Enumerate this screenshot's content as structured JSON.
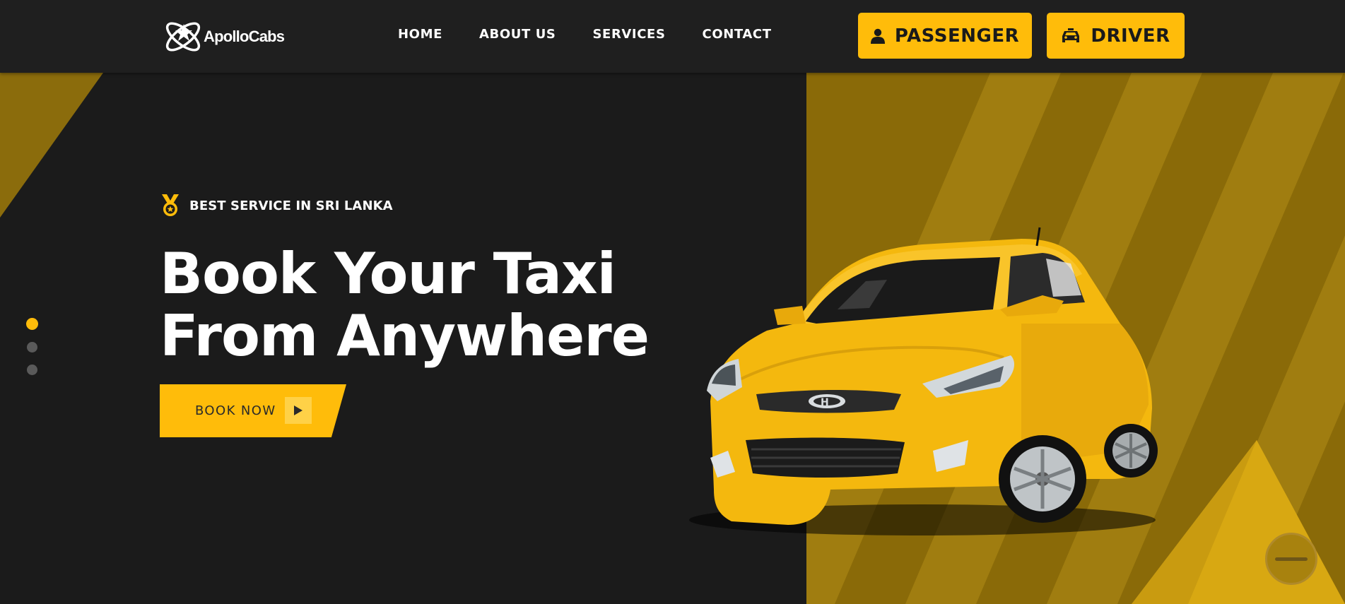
{
  "brand": {
    "name": "ApolloCabs"
  },
  "nav": {
    "links": [
      {
        "label": "HOME"
      },
      {
        "label": "ABOUT US"
      },
      {
        "label": "SERVICES"
      },
      {
        "label": "CONTACT"
      }
    ]
  },
  "header_buttons": {
    "passenger": {
      "label": "PASSENGER",
      "icon": "user-icon"
    },
    "driver": {
      "label": "DRIVER",
      "icon": "car-icon"
    }
  },
  "hero": {
    "badge_text": "BEST SERVICE IN SRI LANKA",
    "badge_icon": "medal-icon",
    "title_line1": "Book Your Taxi",
    "title_line2": "From Anywhere",
    "cta_label": "BOOK NOW",
    "cta_icon": "play-icon",
    "slider": {
      "total": 3,
      "active_index": 0
    }
  },
  "colors": {
    "accent": "#ffbc0a",
    "background": "#1b1b1b",
    "header": "#1f1f1f",
    "panel_dark": "#8a6b0a",
    "panel_light": "#a07d10"
  }
}
